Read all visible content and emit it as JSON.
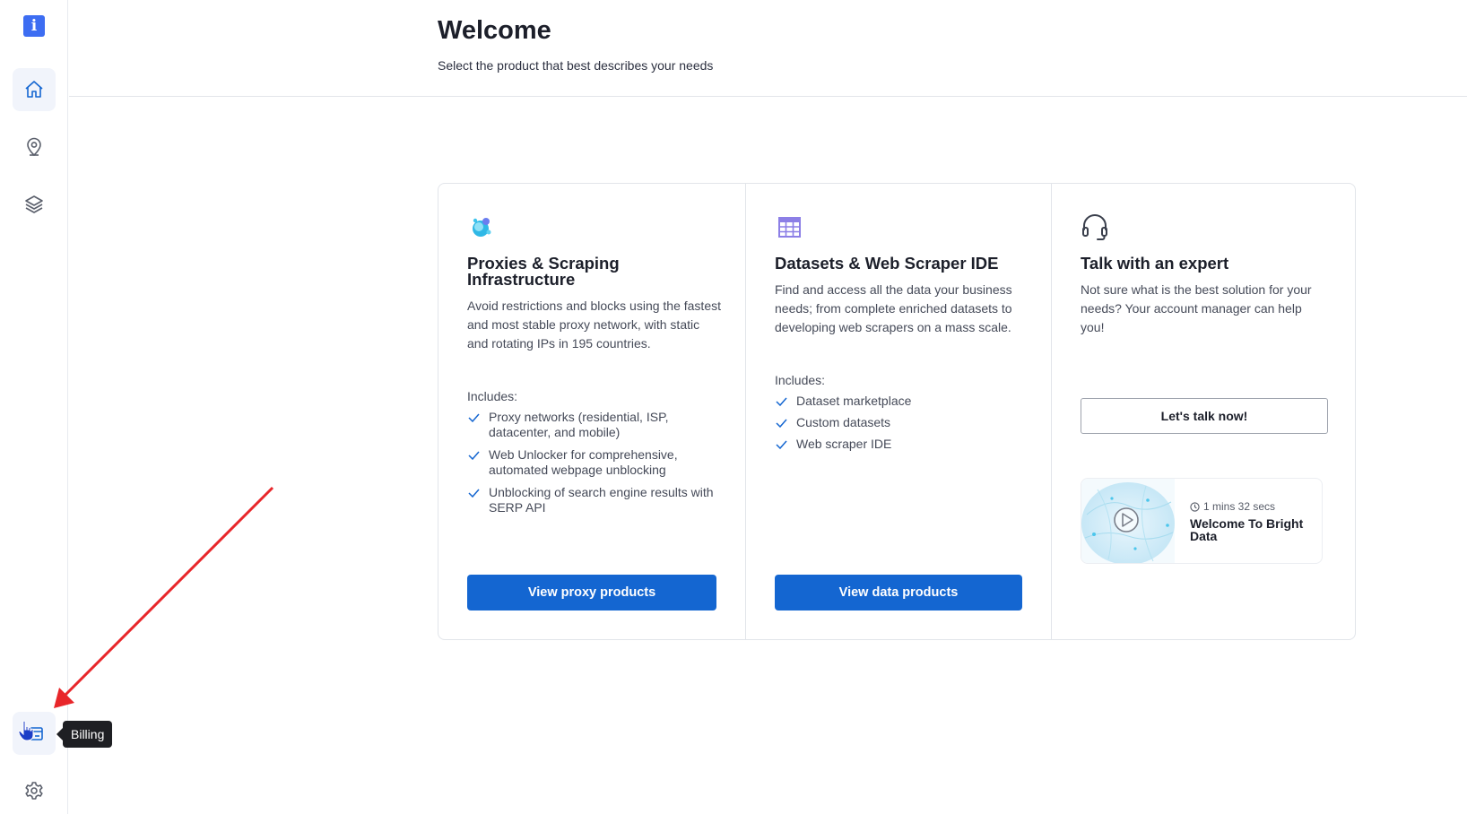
{
  "sidebar": {
    "logo_glyph": "i",
    "items": [
      {
        "name": "home-icon",
        "active": true
      },
      {
        "name": "map-pin-icon",
        "active": false
      },
      {
        "name": "layers-icon",
        "active": false
      },
      {
        "name": "billing-icon",
        "active": false
      },
      {
        "name": "settings-icon",
        "active": false
      }
    ],
    "tooltip": "Billing"
  },
  "header": {
    "title": "Welcome",
    "subtitle": "Select the product that best describes your needs"
  },
  "cards": [
    {
      "icon": "proxies-icon",
      "title": "Proxies & Scraping Infrastructure",
      "description": "Avoid restrictions and blocks using the fastest and most stable proxy network, with static and rotating IPs in 195 countries.",
      "includes_label": "Includes:",
      "includes": [
        "Proxy networks (residential, ISP, datacenter, and mobile)",
        "Web Unlocker for comprehensive, automated webpage unblocking",
        "Unblocking of search engine results with SERP API"
      ],
      "button": "View proxy products"
    },
    {
      "icon": "table-icon",
      "title": "Datasets & Web Scraper IDE",
      "description": "Find and access all the data your business needs; from complete enriched datasets to developing web scrapers on a mass scale.",
      "includes_label": "Includes:",
      "includes": [
        "Dataset marketplace",
        "Custom datasets",
        "Web scraper IDE"
      ],
      "button": "View data products"
    },
    {
      "icon": "headset-icon",
      "title": "Talk with an expert",
      "description": "Not sure what is the best solution for your needs? Your account manager can help you!",
      "button": "Let's talk now!",
      "video": {
        "duration": "1 mins 32 secs",
        "title": "Welcome To Bright Data"
      }
    }
  ],
  "colors": {
    "primary": "#1466d1",
    "logo": "#3d6df2",
    "annotation_arrow": "#e8262a"
  }
}
